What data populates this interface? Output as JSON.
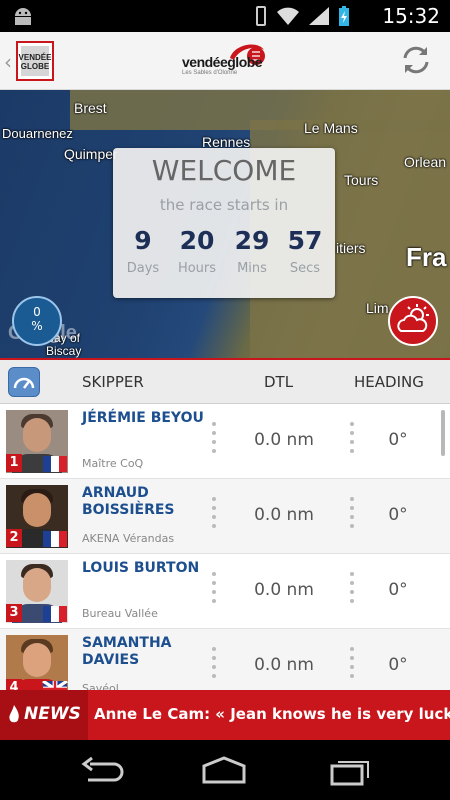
{
  "status_bar": {
    "time": "15:32"
  },
  "header": {
    "app_badge": "VENDÉE GLOBE",
    "logo_word": "vendéeglobe",
    "logo_sub": "Les Sables d'Olonne"
  },
  "map": {
    "labels": [
      "Brest",
      "Douarnenez",
      "Quimper",
      "Rennes",
      "Le Mans",
      "Orlean",
      "Tours",
      "itiers",
      "Fra",
      "Lim",
      "Bay of Biscay"
    ],
    "watermark": "Google",
    "completion": "0\n%"
  },
  "welcome": {
    "title": "WELCOME",
    "subtitle": "the race starts in",
    "countdown": [
      {
        "value": "9",
        "unit": "Days"
      },
      {
        "value": "20",
        "unit": "Hours"
      },
      {
        "value": "29",
        "unit": "Mins"
      },
      {
        "value": "57",
        "unit": "Secs"
      }
    ]
  },
  "table": {
    "headers": {
      "skipper": "SKIPPER",
      "dtl": "DTL",
      "heading": "HEADING"
    },
    "rows": [
      {
        "rank": "1",
        "name": "JÉRÉMIE BEYOU",
        "boat": "Maître CoQ",
        "dtl": "0.0 nm",
        "heading": "0°",
        "flag": "fr"
      },
      {
        "rank": "2",
        "name": "ARNAUD BOISSIÈRES",
        "boat": "AKENA Vérandas",
        "dtl": "0.0 nm",
        "heading": "0°",
        "flag": "fr"
      },
      {
        "rank": "3",
        "name": "LOUIS BURTON",
        "boat": "Bureau Vallée",
        "dtl": "0.0 nm",
        "heading": "0°",
        "flag": "fr"
      },
      {
        "rank": "4",
        "name": "SAMANTHA DAVIES",
        "boat": "Savéol",
        "dtl": "0.0 nm",
        "heading": "0°",
        "flag": "uk"
      }
    ]
  },
  "news": {
    "label": "NEWS",
    "ticker": "Anne Le Cam: « Jean knows he is very lucky to c"
  },
  "colors": {
    "brand_red": "#c8161c",
    "skipper_blue": "#1d4f8f",
    "countdown_navy": "#1d2e57"
  }
}
